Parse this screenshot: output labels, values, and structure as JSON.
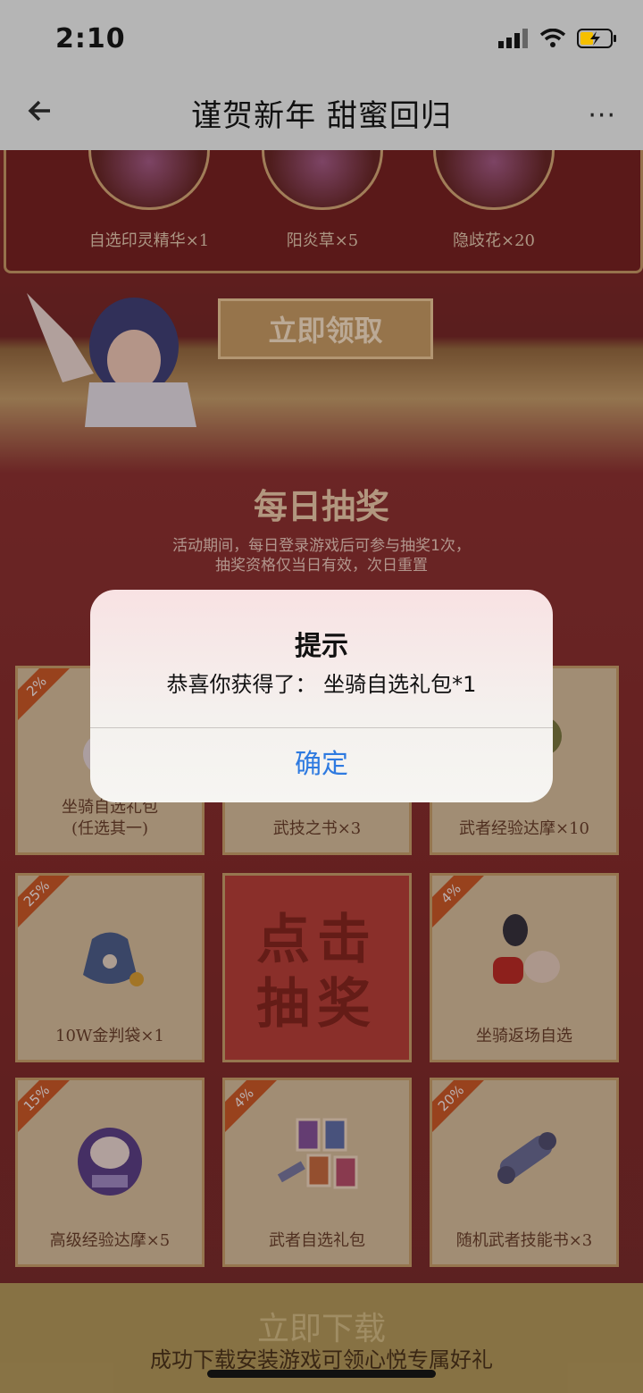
{
  "status_bar": {
    "time": "2:10"
  },
  "nav": {
    "title": "谨贺新年 甜蜜回归",
    "more": "···"
  },
  "rewards": [
    {
      "label": "自选印灵精华×1"
    },
    {
      "label": "阳炎草×5"
    },
    {
      "label": "隐歧花×20"
    }
  ],
  "claim_button": "立即领取",
  "daily": {
    "title": "每日抽奖",
    "desc_line1": "活动期间，每日登录游戏后可参与抽奖1次，",
    "desc_line2": "抽奖资格仅当日有效，次日重置"
  },
  "grid": {
    "items": [
      {
        "pct": "2%",
        "label": "坐骑自选礼包",
        "label2": "(任选其一)",
        "icon": "deer-mount-icon"
      },
      {
        "pct": "",
        "label": "武技之书×3",
        "label2": "",
        "icon": "book-icon"
      },
      {
        "pct": "",
        "label": "武者经验达摩×10",
        "label2": "",
        "icon": "daruma-icon"
      },
      {
        "pct": "25%",
        "label": "10W金判袋×1",
        "label2": "",
        "icon": "money-bag-icon"
      },
      {
        "pct": "4%",
        "label": "坐骑返场自选",
        "label2": "",
        "icon": "mount-select-icon"
      },
      {
        "pct": "15%",
        "label": "高级经验达摩×5",
        "label2": "",
        "icon": "daruma-purple-icon"
      },
      {
        "pct": "4%",
        "label": "武者自选礼包",
        "label2": "",
        "icon": "cards-icon"
      },
      {
        "pct": "20%",
        "label": "随机武者技能书×3",
        "label2": "",
        "icon": "scroll-icon"
      }
    ],
    "draw_line1": "点击",
    "draw_line2": "抽奖"
  },
  "dialog": {
    "title": "提示",
    "message": "恭喜你获得了：  坐骑自选礼包*1",
    "ok": "确定"
  },
  "footer": {
    "title": "立即下载",
    "desc": "成功下载安装游戏可领心悦专属好礼"
  },
  "colors": {
    "accent_blue": "#2e7ae0",
    "badge_orange": "#c9571e"
  }
}
